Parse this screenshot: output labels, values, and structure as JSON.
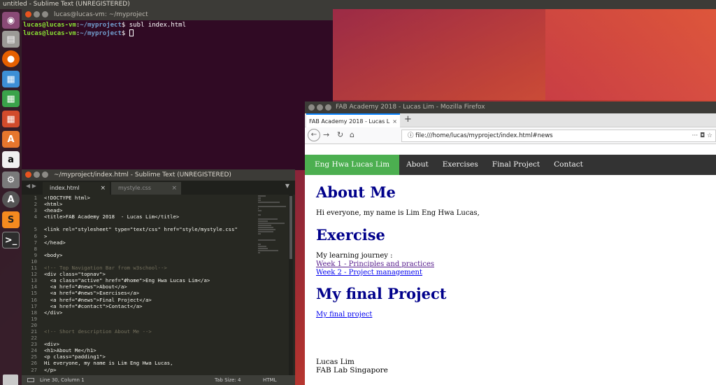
{
  "topbar": {
    "title": "untitled - Sublime Text (UNREGISTERED)"
  },
  "launcher": {
    "items": [
      "dash-icon",
      "files-icon",
      "firefox-icon",
      "writer-icon",
      "calc-icon",
      "impress-icon",
      "software-center-icon",
      "amazon-icon",
      "settings-icon",
      "updater-icon",
      "sublime-icon",
      "terminal-icon"
    ]
  },
  "terminal": {
    "title": "lucas@lucas-vm: ~/myproject",
    "lines": [
      {
        "user": "lucas@lucas-vm",
        "path": "~/myproject",
        "cmd": "subl index.html"
      },
      {
        "user": "lucas@lucas-vm",
        "path": "~/myproject",
        "cmd": ""
      }
    ]
  },
  "sublime": {
    "title": "~/myproject/index.html - Sublime Text (UNREGISTERED)",
    "tabs": [
      "index.html",
      "mystyle.css"
    ],
    "lines": [
      "<!DOCTYPE html>",
      "<html>",
      "<head>",
      "<title>FAB Academy 2018  - Lucas Lim</title>",
      "",
      "<link rel=\"stylesheet\" type=\"text/css\" href=\"style/mystyle.css\"",
      ">",
      "</head>",
      "",
      "<body>",
      "",
      "<!-- Top Navigation Bar from w3school-->",
      "<div class=\"topnav\">",
      "  <a class=\"active\" href=\"#home\">Eng Hwa Lucas Lim</a>",
      "  <a href=\"#news\">About</a>",
      "  <a href=\"#news\">Exercises</a>",
      "  <a href=\"#news\">Final Project</a>",
      "  <a href=\"#contact\">Contact</a>",
      "</div>",
      "",
      "",
      "<!-- Short description About Me -->",
      "",
      "<div>",
      "<h1>About Me</h1>",
      "<p class=\"padding1\">",
      "Hi everyone, my name is Lim Eng Hwa Lucas,",
      "</p>"
    ],
    "line_numbers": [
      "1",
      "2",
      "3",
      "4",
      "",
      "5",
      "6",
      "7",
      "8",
      "9",
      "10",
      "11",
      "12",
      "13",
      "14",
      "15",
      "16",
      "17",
      "18",
      "19",
      "20",
      "21",
      "22",
      "23",
      "24",
      "25",
      "26",
      "27"
    ],
    "status_position": "Line 30, Column 1",
    "status_tab": "Tab Size: 4",
    "status_syntax": "HTML"
  },
  "firefox": {
    "title": "FAB Academy 2018 - Lucas Lim - Mozilla Firefox",
    "tab_title": "FAB Academy 2018 - Lucas L",
    "url": "file:///home/lucas/myproject/index.html#news",
    "nav": [
      "Eng Hwa Lucas Lim",
      "About",
      "Exercises",
      "Final Project",
      "Contact"
    ],
    "about_heading": "About Me",
    "about_text": "Hi everyone, my name is Lim Eng Hwa Lucas,",
    "exercise_heading": "Exercise",
    "exercise_intro": "My learning journey :",
    "exercise_links": [
      "Week 1 - Principles and practices",
      "Week 2 - Project management"
    ],
    "project_heading": "My final Project",
    "project_link": "My final project",
    "footer_name": "Lucas Lim",
    "footer_org": "FAB Lab Singapore"
  },
  "colors": {
    "desktop_accent": "#e0553a",
    "nav_active": "#4caf50",
    "heading": "#00008b",
    "terminal_bg": "#300a24",
    "editor_bg": "#272822"
  }
}
